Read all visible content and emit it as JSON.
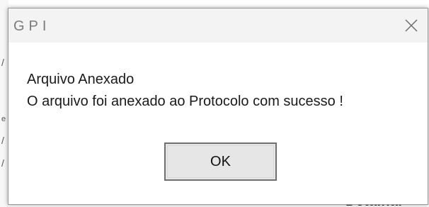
{
  "dialog": {
    "title": "GPI",
    "close_icon": "close-icon",
    "message_title": "Arquivo Anexado",
    "message_text": "O arquivo foi anexado ao Protocolo com sucesso !",
    "ok_label": "OK"
  },
  "background": {
    "partial_text": "Detalhar"
  },
  "colors": {
    "titlebar_bg": "#f3f3f3",
    "title_text": "#7c7c7c",
    "dialog_border": "#9a9a9a",
    "button_bg": "#e6e6e6",
    "button_border": "#6f6f6f"
  }
}
